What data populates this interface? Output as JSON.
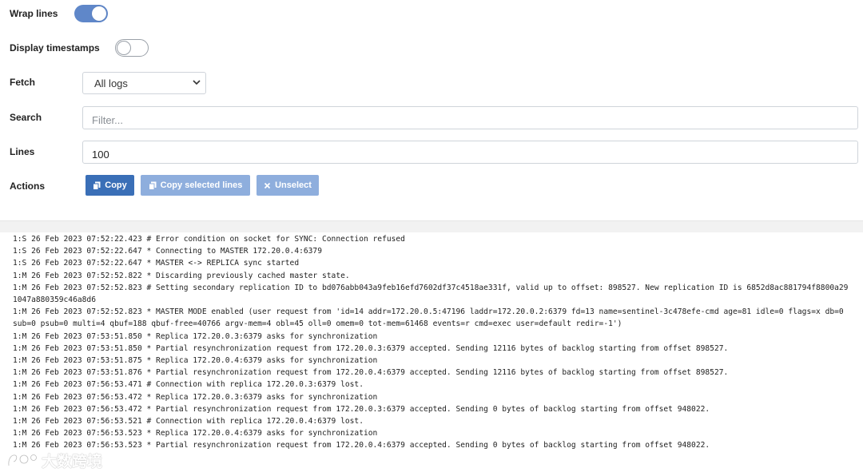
{
  "settings": {
    "wrap_lines": {
      "label": "Wrap lines",
      "enabled": true
    },
    "display_timestamps": {
      "label": "Display timestamps",
      "enabled": false
    },
    "fetch": {
      "label": "Fetch",
      "value": "All logs"
    },
    "search": {
      "label": "Search",
      "placeholder": "Filter...",
      "value": ""
    },
    "lines": {
      "label": "Lines",
      "value": "100"
    },
    "actions": {
      "label": "Actions",
      "copy": "Copy",
      "copy_selected": "Copy selected lines",
      "unselect": "Unselect"
    }
  },
  "colors": {
    "accent": "#3a6fb7",
    "accent_disabled": "#8eaedd",
    "toggle_on": "#5f87c9"
  },
  "logs": [
    "1:S 26 Feb 2023 07:52:22.423 # Error condition on socket for SYNC: Connection refused",
    "1:S 26 Feb 2023 07:52:22.647 * Connecting to MASTER 172.20.0.4:6379",
    "1:S 26 Feb 2023 07:52:22.647 * MASTER <-> REPLICA sync started",
    "1:M 26 Feb 2023 07:52:52.822 * Discarding previously cached master state.",
    "1:M 26 Feb 2023 07:52:52.823 # Setting secondary replication ID to bd076abb043a9feb16efd7602df37c4518ae331f, valid up to offset: 898527. New replication ID is 6852d8ac881794f8800a291047a880359c46a8d6",
    "1:M 26 Feb 2023 07:52:52.823 * MASTER MODE enabled (user request from 'id=14 addr=172.20.0.5:47196 laddr=172.20.0.2:6379 fd=13 name=sentinel-3c478efe-cmd age=81 idle=0 flags=x db=0 sub=0 psub=0 multi=4 qbuf=188 qbuf-free=40766 argv-mem=4 obl=45 oll=0 omem=0 tot-mem=61468 events=r cmd=exec user=default redir=-1')",
    "1:M 26 Feb 2023 07:53:51.850 * Replica 172.20.0.3:6379 asks for synchronization",
    "1:M 26 Feb 2023 07:53:51.850 * Partial resynchronization request from 172.20.0.3:6379 accepted. Sending 12116 bytes of backlog starting from offset 898527.",
    "1:M 26 Feb 2023 07:53:51.875 * Replica 172.20.0.4:6379 asks for synchronization",
    "1:M 26 Feb 2023 07:53:51.876 * Partial resynchronization request from 172.20.0.4:6379 accepted. Sending 12116 bytes of backlog starting from offset 898527.",
    "1:M 26 Feb 2023 07:56:53.471 # Connection with replica 172.20.0.3:6379 lost.",
    "1:M 26 Feb 2023 07:56:53.472 * Replica 172.20.0.3:6379 asks for synchronization",
    "1:M 26 Feb 2023 07:56:53.472 * Partial resynchronization request from 172.20.0.3:6379 accepted. Sending 0 bytes of backlog starting from offset 948022.",
    "1:M 26 Feb 2023 07:56:53.521 # Connection with replica 172.20.0.4:6379 lost.",
    "1:M 26 Feb 2023 07:56:53.523 * Replica 172.20.0.4:6379 asks for synchronization",
    "1:M 26 Feb 2023 07:56:53.523 * Partial resynchronization request from 172.20.0.4:6379 accepted. Sending 0 bytes of backlog starting from offset 948022."
  ],
  "watermark": {
    "text": "大数跨境"
  }
}
